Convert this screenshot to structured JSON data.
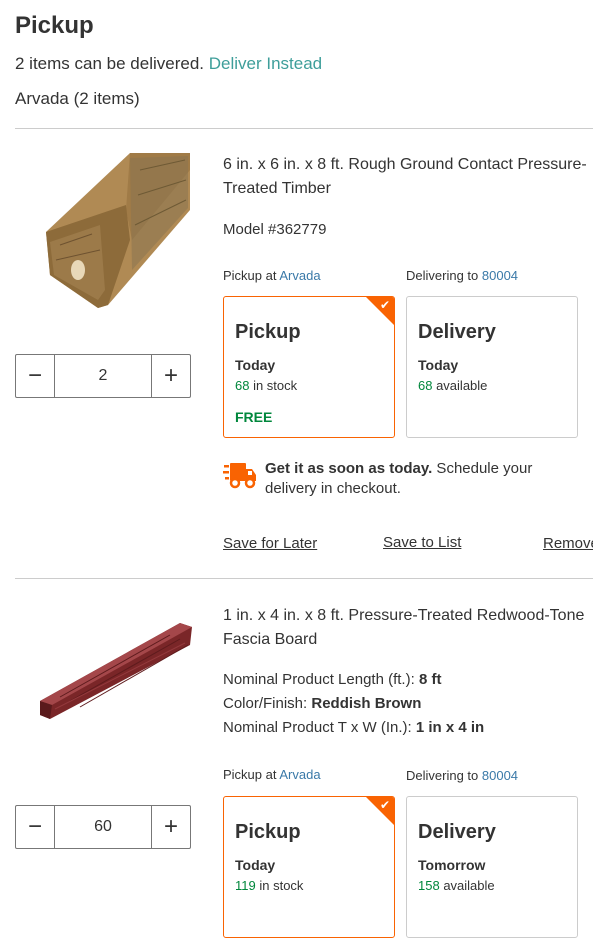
{
  "header": {
    "title": "Pickup",
    "deliver_text": "2 items can be delivered.",
    "deliver_link": "Deliver Instead",
    "store_group": "Arvada (2 items)"
  },
  "items": [
    {
      "title": "6 in. x 6 in. x 8 ft. Rough Ground Contact Pressure-Treated Timber",
      "model": "Model #362779",
      "quantity": "2",
      "pickup_label": "Pickup at",
      "pickup_store": "Arvada",
      "delivery_label": "Delivering to",
      "delivery_zip": "80004",
      "pickup_card": {
        "title": "Pickup",
        "day": "Today",
        "stock_num": "68",
        "stock_text": " in stock",
        "price": "FREE",
        "selected": true
      },
      "delivery_card": {
        "title": "Delivery",
        "day": "Today",
        "stock_num": "68",
        "stock_text": " available"
      },
      "promo_bold": "Get it as soon as today.",
      "promo_text": " Schedule your delivery in checkout.",
      "actions": {
        "save_later": "Save for Later",
        "save_list": "Save to List",
        "remove": "Remove"
      }
    },
    {
      "title": "1 in. x 4 in. x 8 ft. Pressure-Treated Redwood-Tone Fascia Board",
      "specs": [
        {
          "label": "Nominal Product Length (ft.): ",
          "value": "8 ft"
        },
        {
          "label": "Color/Finish: ",
          "value": "Reddish Brown"
        },
        {
          "label": "Nominal Product T x W (In.): ",
          "value": "1 in x 4 in"
        }
      ],
      "quantity": "60",
      "pickup_label": "Pickup at",
      "pickup_store": "Arvada",
      "delivery_label": "Delivering to",
      "delivery_zip": "80004",
      "pickup_card": {
        "title": "Pickup",
        "day": "Today",
        "stock_num": "119",
        "stock_text": " in stock",
        "selected": true
      },
      "delivery_card": {
        "title": "Delivery",
        "day": "Tomorrow",
        "stock_num": "158",
        "stock_text": " available"
      }
    }
  ],
  "icons": {
    "minus": "minus-icon",
    "plus": "plus-icon",
    "check": "check-icon",
    "truck": "fast-delivery-truck-icon"
  },
  "colors": {
    "accent": "#f96302",
    "green": "#00873c",
    "teal_link": "#3e9e9a",
    "blue_link": "#3a79a8"
  }
}
